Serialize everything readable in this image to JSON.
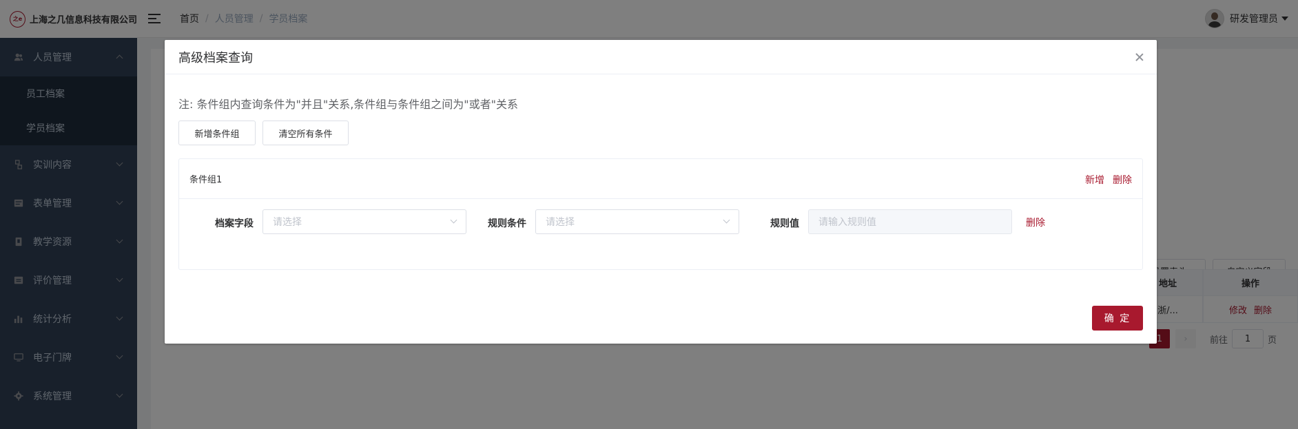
{
  "app": {
    "logo_mark": "之e",
    "company": "上海之几信息科技有限公司"
  },
  "header": {
    "breadcrumb": [
      "首页",
      "人员管理",
      "学员档案"
    ],
    "user_name": "研发管理员"
  },
  "sidebar": {
    "items": [
      {
        "label": "人员管理",
        "icon": "people-icon",
        "expanded": true
      },
      {
        "label": "实训内容",
        "icon": "training-icon"
      },
      {
        "label": "表单管理",
        "icon": "form-icon"
      },
      {
        "label": "教学资源",
        "icon": "resource-icon"
      },
      {
        "label": "评价管理",
        "icon": "evaluation-icon"
      },
      {
        "label": "统计分析",
        "icon": "chart-icon"
      },
      {
        "label": "电子门牌",
        "icon": "monitor-icon"
      },
      {
        "label": "系统管理",
        "icon": "gear-icon"
      }
    ],
    "submenu": [
      {
        "label": "员工档案"
      },
      {
        "label": "学员档案",
        "active": true
      }
    ]
  },
  "background": {
    "set_header_button": "设置表头",
    "custom_field_button": "自定义字段",
    "table_col_address": "地址",
    "table_col_actions": "操作",
    "row_address": "浙/...",
    "row_edit": "修改",
    "row_delete": "删除",
    "pager_current": "1",
    "goto_prefix": "前往",
    "goto_value": "1",
    "goto_suffix": "页"
  },
  "dialog": {
    "title": "高级档案查询",
    "note": "注: 条件组内查询条件为\"并且\"关系,条件组与条件组之间为\"或者\"关系",
    "add_group_button": "新增条件组",
    "clear_button": "清空所有条件",
    "group": {
      "title": "条件组1",
      "add_link": "新增",
      "delete_link": "删除",
      "field_label": "档案字段",
      "field_placeholder": "请选择",
      "rule_label": "规则条件",
      "rule_placeholder": "请选择",
      "value_label": "规则值",
      "value_placeholder": "请输入规则值",
      "row_delete_link": "删除"
    },
    "confirm_button": "确 定"
  },
  "colors": {
    "accent": "#a8192e",
    "sidebar_bg": "#304156"
  }
}
